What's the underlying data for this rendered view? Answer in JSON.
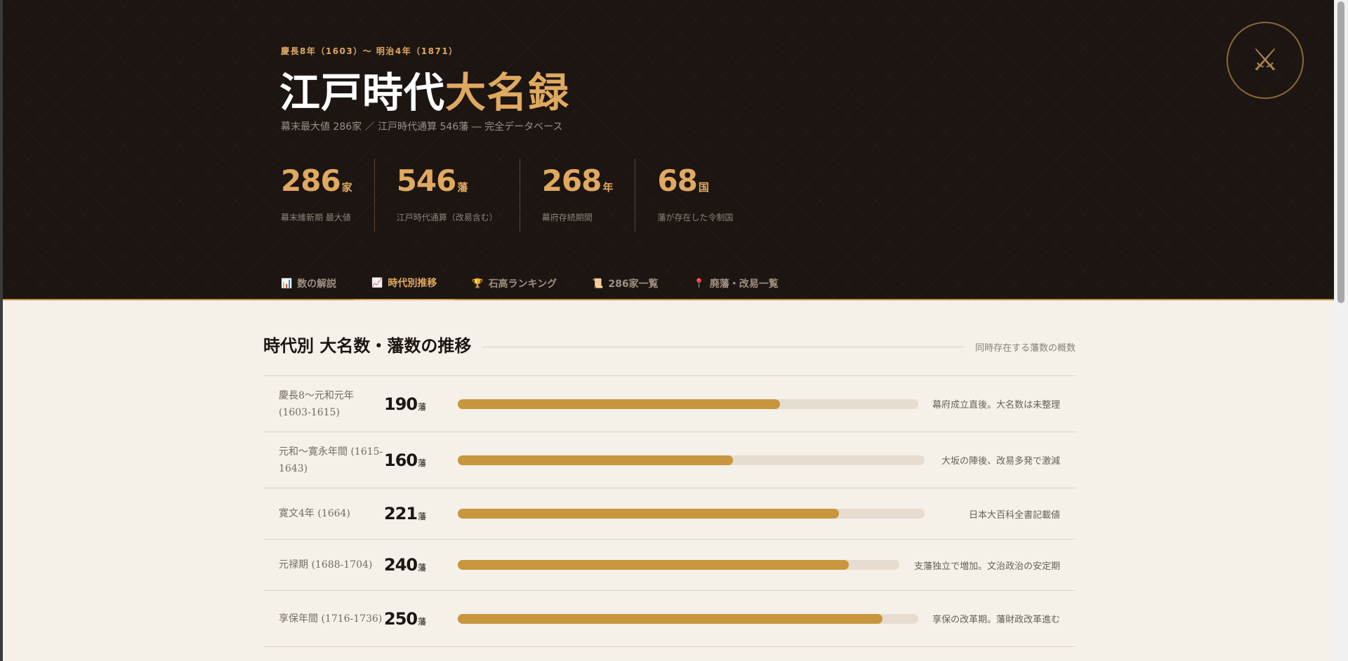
{
  "header": {
    "period": "慶長8年（1603）〜 明治4年（1871）",
    "title_main": "江戸時代",
    "title_accent": "大名録",
    "subtitle": "幕末最大値 286家 ／ 江戸時代通算 546藩 ― 完全データベース",
    "emblem": "⚔"
  },
  "stats": [
    {
      "value": "286",
      "unit": "家",
      "label": "幕末維新期 最大値"
    },
    {
      "value": "546",
      "unit": "藩",
      "label": "江戸時代通算（改易含む）"
    },
    {
      "value": "268",
      "unit": "年",
      "label": "幕府存続期間"
    },
    {
      "value": "68",
      "unit": "国",
      "label": "藩が存在した令制国"
    }
  ],
  "tabs": [
    {
      "icon": "📊",
      "label": "数の解説"
    },
    {
      "icon": "📈",
      "label": "時代別推移"
    },
    {
      "icon": "🏆",
      "label": "石高ランキング"
    },
    {
      "icon": "📜",
      "label": "286家一覧"
    },
    {
      "icon": "📍",
      "label": "廃藩・改易一覧"
    }
  ],
  "active_tab": 1,
  "section": {
    "title": "時代別 大名数・藩数の推移",
    "note": "同時存在する藩数の概数"
  },
  "rows": [
    {
      "era": "慶長8〜元和元年 (1603-1615)",
      "count": "190",
      "unit": "藩",
      "fill": 0.7,
      "note": "幕府成立直後。大名数は未整理"
    },
    {
      "era": "元和〜寛永年間 (1615-1643)",
      "count": "160",
      "unit": "藩",
      "fill": 0.59,
      "note": "大坂の陣後、改易多発で激減"
    },
    {
      "era": "寛文4年 (1664)",
      "count": "221",
      "unit": "藩",
      "fill": 0.816,
      "note": "日本大百科全書記載値"
    },
    {
      "era": "元禄期 (1688-1704)",
      "count": "240",
      "unit": "藩",
      "fill": 0.886,
      "note": "支藩独立で増加。文治政治の安定期"
    },
    {
      "era": "享保年間 (1716-1736)",
      "count": "250",
      "unit": "藩",
      "fill": 0.922,
      "note": "享保の改革期。藩財政改革進む"
    }
  ]
}
